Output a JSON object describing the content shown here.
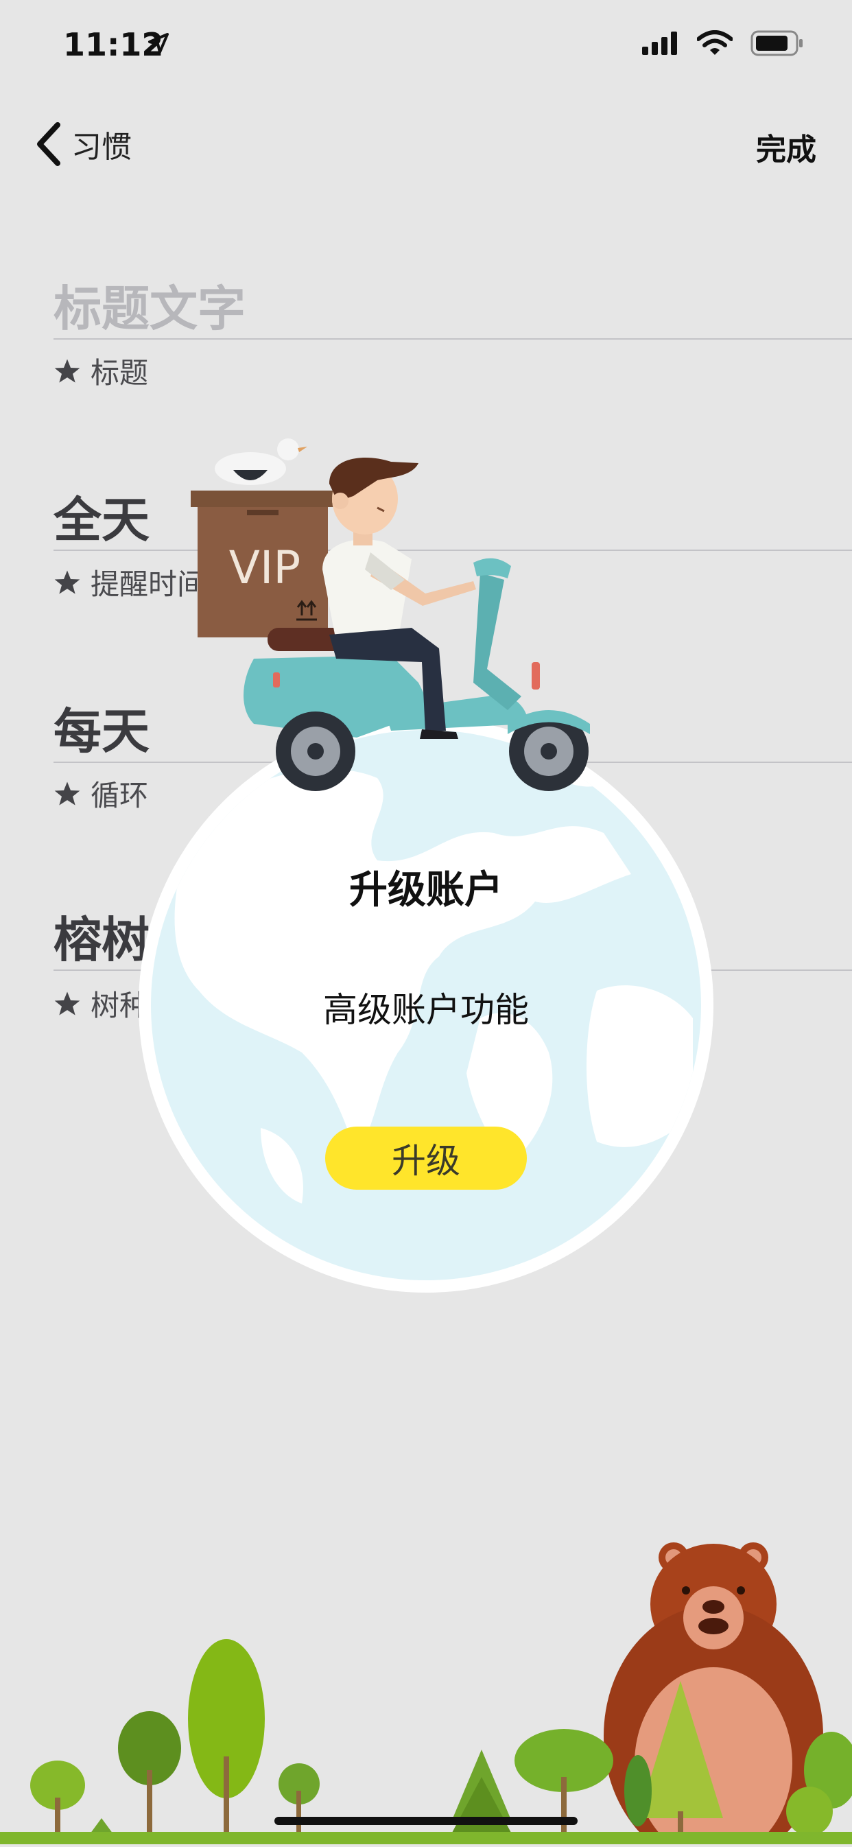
{
  "status_bar": {
    "time": "11:12"
  },
  "nav": {
    "back_label": "习惯",
    "done_label": "完成"
  },
  "form": {
    "rows": [
      {
        "title": "标题文字",
        "subtitle": "标题"
      },
      {
        "title": "全天",
        "subtitle": "提醒时间"
      },
      {
        "title": "每天",
        "subtitle": "循环"
      },
      {
        "title": "榕树",
        "subtitle": "树种"
      }
    ]
  },
  "illustration": {
    "box_label": "VIP"
  },
  "popup": {
    "title": "升级账户",
    "description": "高级账户功能",
    "button_label": "升级"
  },
  "colors": {
    "background": "#e6e6e6",
    "button": "#ffe52b",
    "globe": "#dff3f8",
    "scooter": "#6cc1c2",
    "bear": "#a8421b"
  }
}
